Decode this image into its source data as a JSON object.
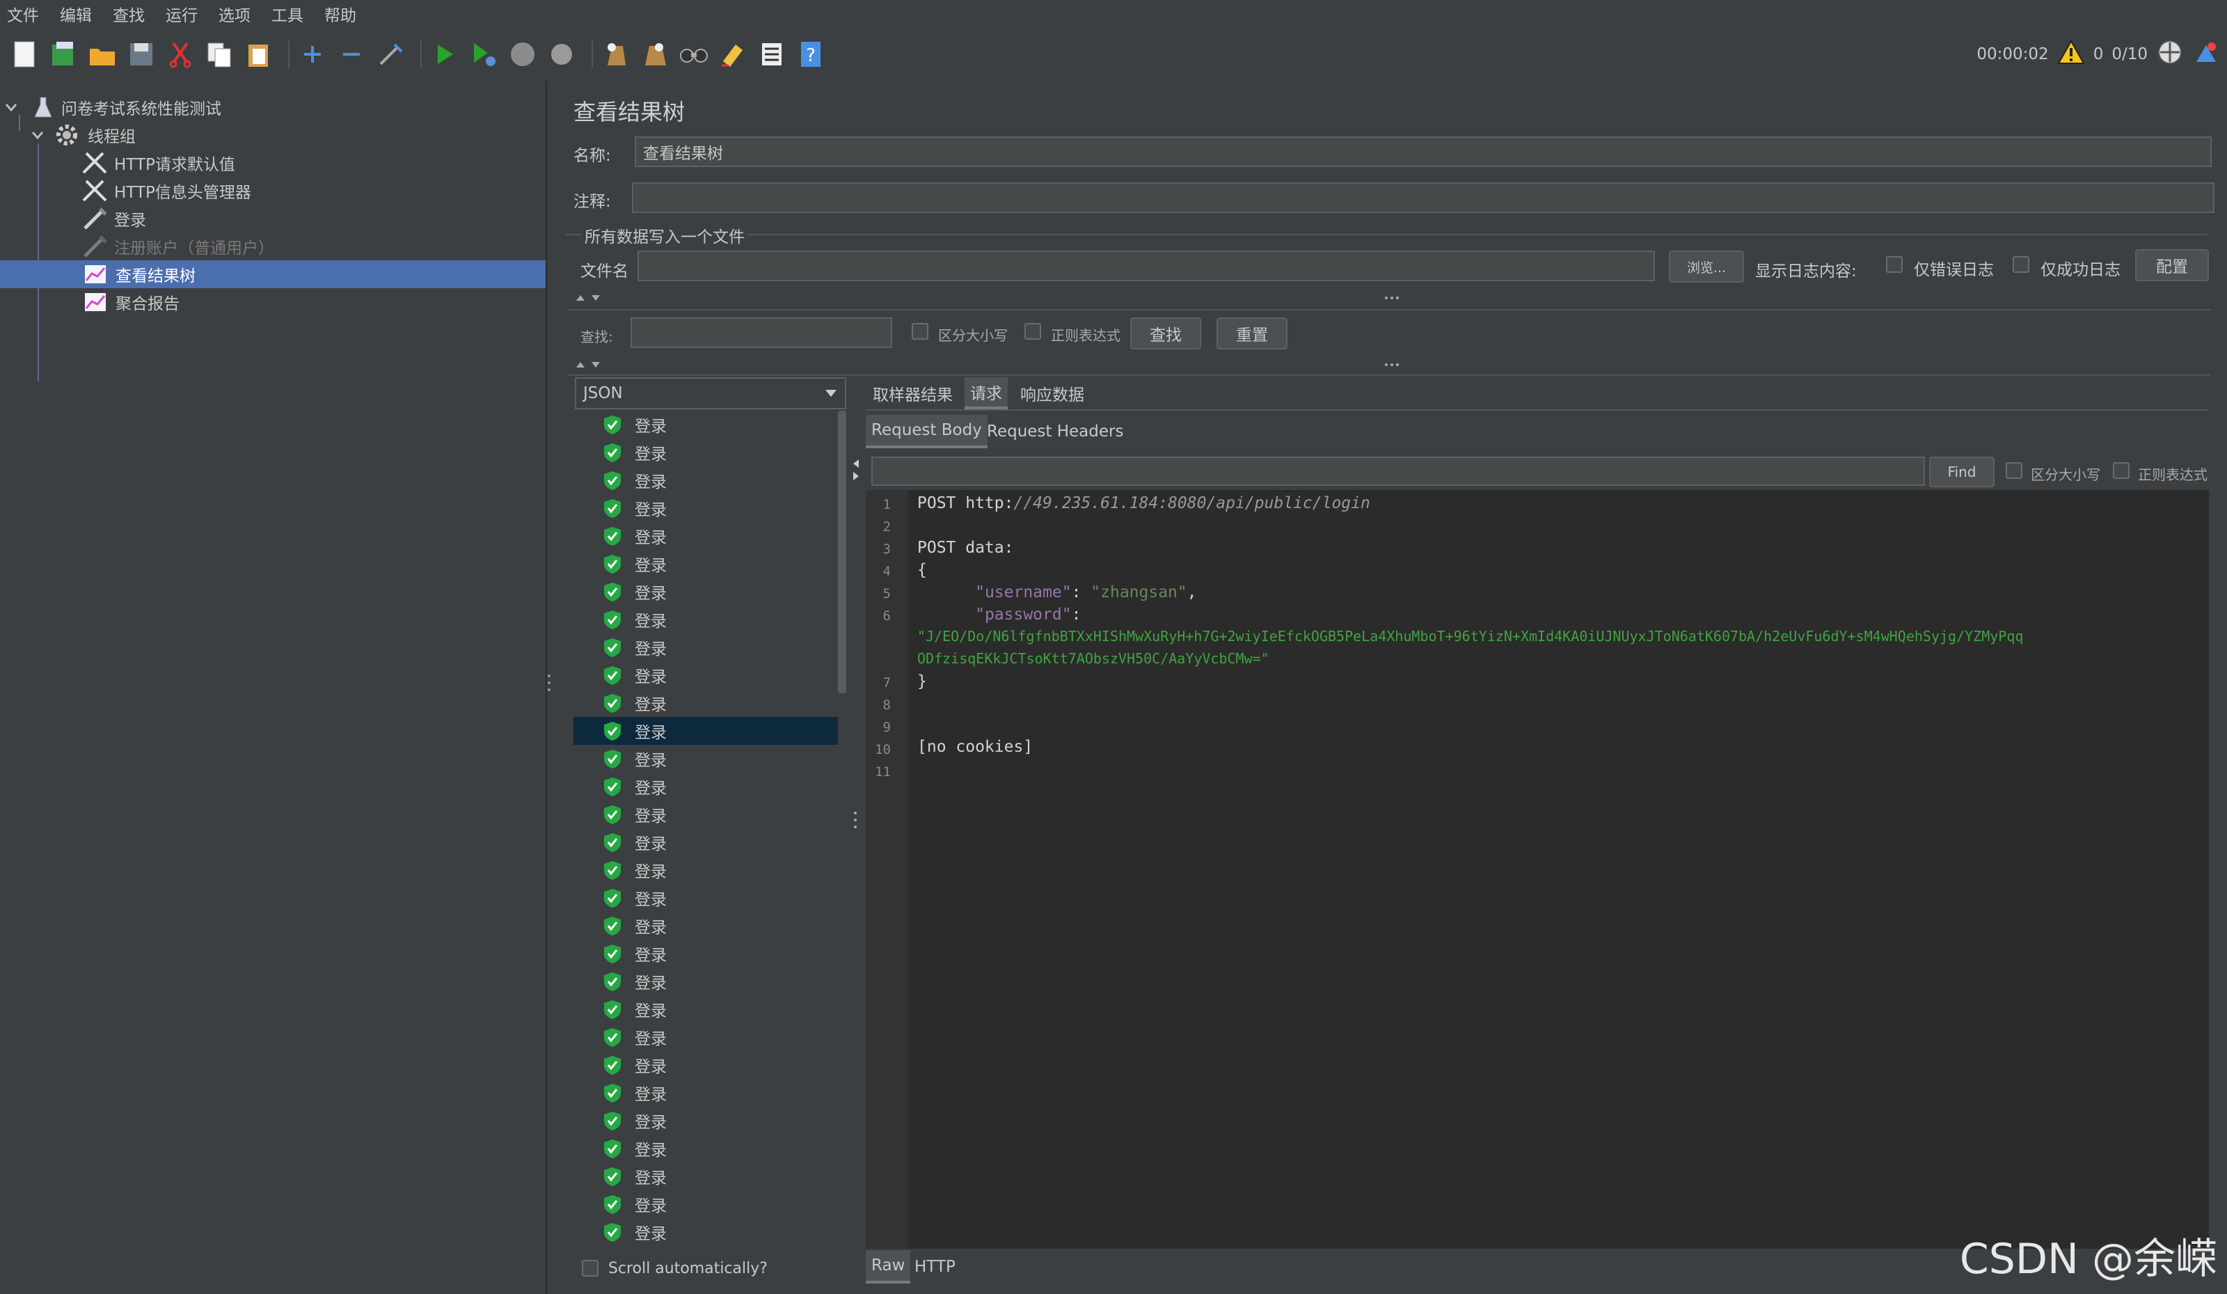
{
  "menu": [
    "文件",
    "编辑",
    "查找",
    "运行",
    "选项",
    "工具",
    "帮助"
  ],
  "toolbar": {
    "elapsed": "00:00:02",
    "warnings": "0",
    "threads": "0/10"
  },
  "tree": {
    "root": "问卷考试系统性能测试",
    "thread_group": "线程组",
    "items": [
      {
        "label": "HTTP请求默认值",
        "icon": "wrench-icon"
      },
      {
        "label": "HTTP信息头管理器",
        "icon": "wrench-icon"
      },
      {
        "label": "登录",
        "icon": "pipette-icon"
      },
      {
        "label": "注册账户（普通用户）",
        "icon": "pipette-icon"
      },
      {
        "label": "查看结果树",
        "icon": "graph-icon"
      },
      {
        "label": "聚合报告",
        "icon": "graph-icon"
      }
    ]
  },
  "panel": {
    "title": "查看结果树",
    "name_label": "名称:",
    "name_value": "查看结果树",
    "comment_label": "注释:",
    "comment_value": "",
    "file_group_title": "所有数据写入一个文件",
    "filename_label": "文件名",
    "filename_value": "",
    "browse_button": "浏览...",
    "log_label": "显示日志内容:",
    "errors_only": "仅错误日志",
    "success_only": "仅成功日志",
    "configure_button": "配置",
    "search_label": "查找:",
    "case_sensitive": "区分大小写",
    "regex": "正则表达式",
    "search_button": "查找",
    "reset_button": "重置"
  },
  "renderer": "JSON",
  "results": {
    "item_label": "登录",
    "count": 30,
    "selected_index": 11,
    "scroll_auto": "Scroll automatically?"
  },
  "tabs": {
    "sampler": "取样器结果",
    "request": "请求",
    "response": "响应数据",
    "request_body": "Request Body",
    "request_headers": "Request Headers",
    "find_button": "Find",
    "find_case": "区分大小写",
    "find_regex": "正则表达式",
    "raw": "Raw",
    "http": "HTTP"
  },
  "code": {
    "line1_prefix": "POST http:",
    "line1_url": "//49.235.61.184:8080/api/public/login",
    "line3": "POST data:",
    "line4": "{",
    "line5_key": "\"username\"",
    "line5_val": "\"zhangsan\"",
    "line6_key": "\"password\"",
    "line6_val_a": "\"J/EO/Do/N6lfgfnbBTXxHIShMwXuRyH+h7G+2wiyIeEfckOGB5PeLa4XhuMboT+96tYizN+XmId4KA0iUJNUyxJToN6atK607bA/h2eUvFu6dY+sM4wHQehSyjg/YZMyPqq",
    "line6_val_b": "ODfzisqEKkJCTsoKtt7AObszVH50C/AaYyVcbCMw=\"",
    "line7": "}",
    "line10": "[no cookies]"
  },
  "watermark": "CSDN @余嵘",
  "colors": {
    "background": "#3c3f41",
    "selection": "#4b6eaf",
    "result_selected": "#0d293e",
    "success_green": "#27a844"
  }
}
